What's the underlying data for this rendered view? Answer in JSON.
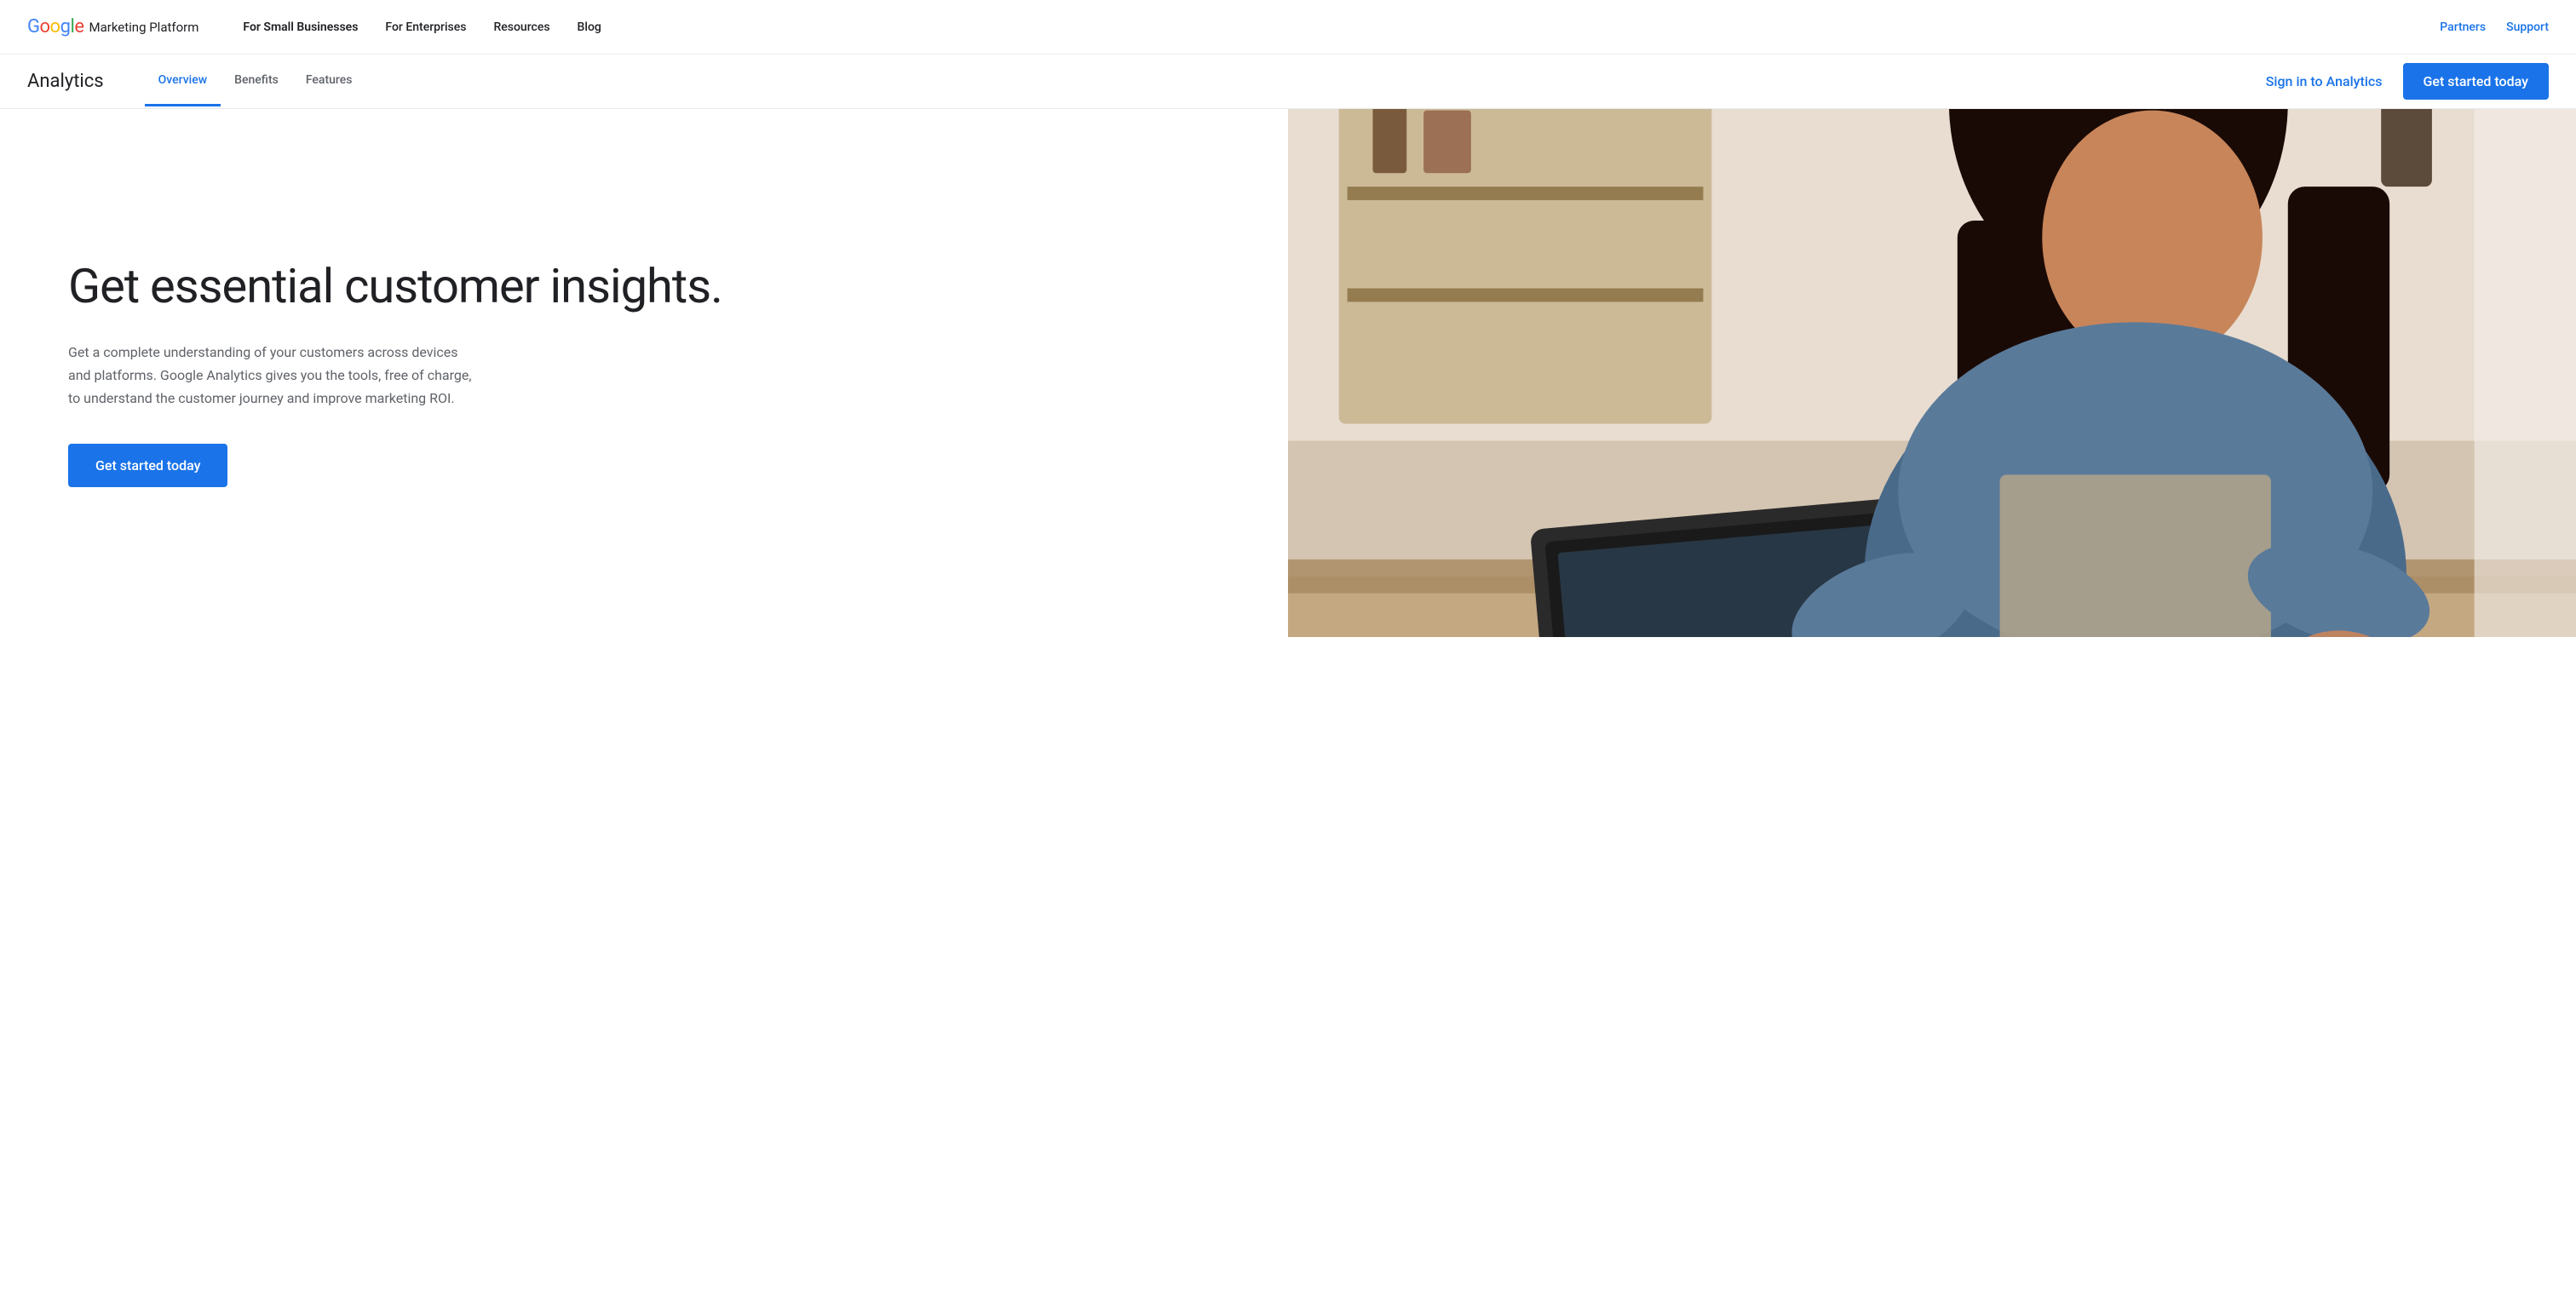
{
  "top_nav": {
    "logo": {
      "google_text": "Google",
      "platform_text": "Marketing Platform"
    },
    "links": [
      {
        "label": "For Small Businesses",
        "active": true
      },
      {
        "label": "For Enterprises"
      },
      {
        "label": "Resources"
      },
      {
        "label": "Blog"
      }
    ],
    "right_links": [
      {
        "label": "Partners"
      },
      {
        "label": "Support"
      }
    ]
  },
  "secondary_nav": {
    "title": "Analytics",
    "links": [
      {
        "label": "Overview",
        "active": true
      },
      {
        "label": "Benefits"
      },
      {
        "label": "Features"
      }
    ],
    "sign_in_label": "Sign in to Analytics",
    "get_started_label": "Get started today"
  },
  "hero": {
    "headline": "Get essential customer insights.",
    "description": "Get a complete understanding of your customers across devices and platforms. Google Analytics gives you the tools, free of charge, to understand the customer journey and improve marketing ROI.",
    "cta_label": "Get started today"
  },
  "colors": {
    "google_blue": "#4285F4",
    "google_red": "#EA4335",
    "google_yellow": "#FBBC05",
    "google_green": "#34A853",
    "primary_blue": "#1a73e8",
    "text_dark": "#202124",
    "text_medium": "#5f6368"
  }
}
